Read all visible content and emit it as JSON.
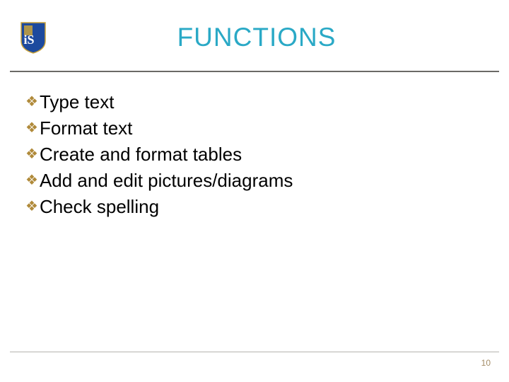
{
  "header": {
    "title": "FUNCTIONS",
    "logo_name": "shield-logo"
  },
  "bullets": {
    "items": [
      {
        "text": "Type text"
      },
      {
        "text": "Format text"
      },
      {
        "text": "Create and format tables"
      },
      {
        "text": "Add and edit pictures/diagrams"
      },
      {
        "text": "Check spelling"
      }
    ]
  },
  "footer": {
    "page_number": "10"
  },
  "colors": {
    "title": "#2aa9c6",
    "bullet": "#b08a3a"
  }
}
